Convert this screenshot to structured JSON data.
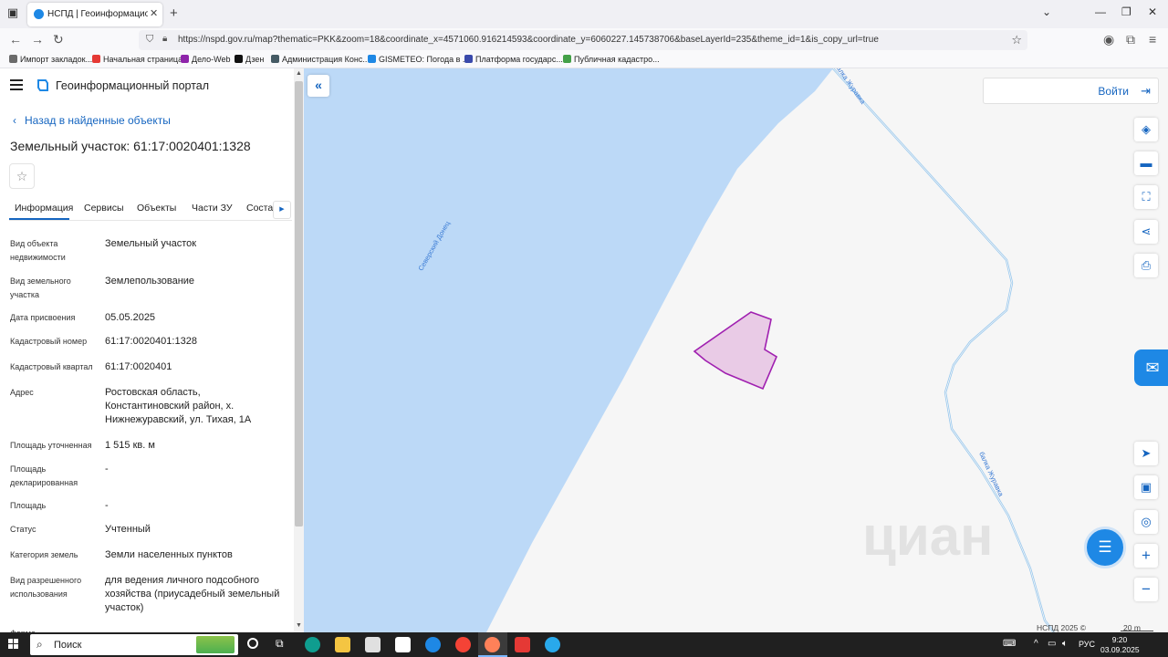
{
  "browser": {
    "tab_title": "НСПД | Геоинформационный",
    "url": "https://nspd.gov.ru/map?thematic=PKK&zoom=18&coordinate_x=4571060.916214593&coordinate_y=6060227.145738706&baseLayerId=235&theme_id=1&is_copy_url=true",
    "bookmarks": [
      {
        "label": "Импорт закладок...",
        "color": "#6b6b6b"
      },
      {
        "label": "Начальная страница",
        "color": "#e53935"
      },
      {
        "label": "Дело-Web",
        "color": "#8e24aa"
      },
      {
        "label": "Дзен",
        "color": "#111111"
      },
      {
        "label": "Администрация Конс...",
        "color": "#455a64"
      },
      {
        "label": "GISMETEO: Погода в ...",
        "color": "#1e88e5"
      },
      {
        "label": "Платформа государс...",
        "color": "#3949ab"
      },
      {
        "label": "Публичная кадастро...",
        "color": "#43a047"
      }
    ]
  },
  "portal": {
    "title": "Геоинформационный портал",
    "back_label": "Назад в найденные объекты",
    "object_title": "Земельный участок: 61:17:0020401:1328",
    "tabs": [
      "Информация",
      "Сервисы",
      "Объекты",
      "Части ЗУ",
      "Соста"
    ]
  },
  "properties": [
    {
      "key": "Вид объекта недвижимости",
      "value": "Земельный участок"
    },
    {
      "key": "Вид земельного участка",
      "value": "Землепользование"
    },
    {
      "key": "Дата присвоения",
      "value": "05.05.2025"
    },
    {
      "key": "Кадастровый номер",
      "value": "61:17:0020401:1328"
    },
    {
      "key": "Кадастровый квартал",
      "value": "61:17:0020401"
    },
    {
      "key": "Адрес",
      "value": "Ростовская область, Константиновский район, х. Нижнежуравский, ул. Тихая, 1А"
    },
    {
      "key": "Площадь уточненная",
      "value": "1 515 кв. м"
    },
    {
      "key": "Площадь декларированная",
      "value": "-"
    },
    {
      "key": "Площадь",
      "value": "-"
    },
    {
      "key": "Статус",
      "value": "Учтенный"
    },
    {
      "key": "Категория земель",
      "value": "Земли населенных пунктов"
    },
    {
      "key": "Вид разрешенного использования",
      "value": "для ведения личного подсобного хозяйства (приусадебный земельный участок)"
    },
    {
      "key": "Форма собственности",
      "value": ""
    }
  ],
  "map": {
    "login_label": "Войти",
    "river_label": "Северский Донец",
    "stream_label_top": "балка Журавка",
    "stream_label_right": "балка Журавка",
    "credit": "НСПД 2025 ©",
    "scale": "20 m",
    "watermark": "циан",
    "colors": {
      "water": "#bcd9f7",
      "land": "#f6f6f6",
      "parcel_fill": "#e9cbe6",
      "parcel_stroke": "#a020b0",
      "accent": "#1565c0"
    }
  },
  "taskbar": {
    "search_label": "Поиск",
    "lang": "РУС",
    "time": "9:20",
    "date": "03.09.2025"
  }
}
